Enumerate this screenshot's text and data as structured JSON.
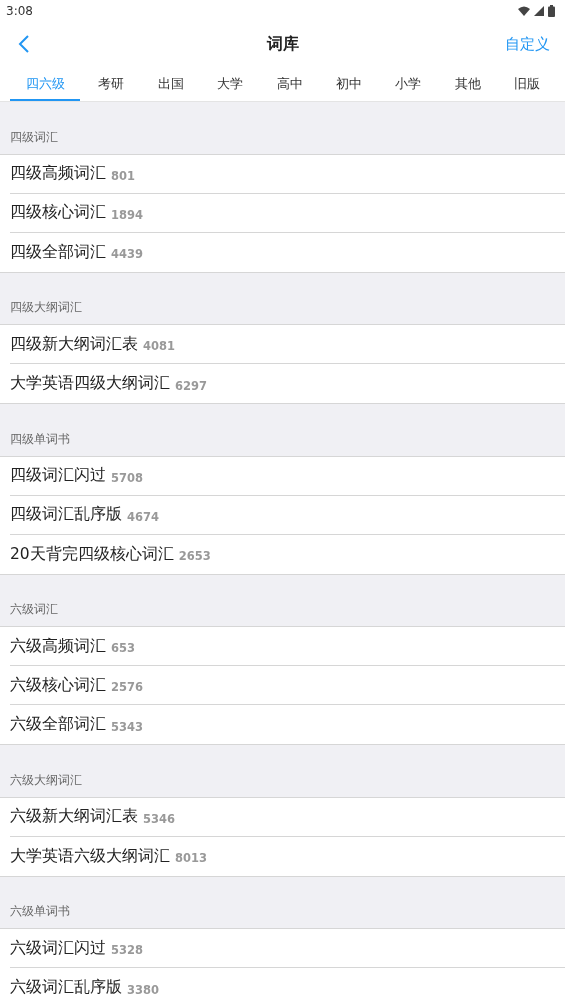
{
  "status_bar": {
    "time": "3:08"
  },
  "header": {
    "title": "词库",
    "action": "自定义"
  },
  "tabs": [
    {
      "label": "四六级",
      "selected": true
    },
    {
      "label": "考研",
      "selected": false
    },
    {
      "label": "出国",
      "selected": false
    },
    {
      "label": "大学",
      "selected": false
    },
    {
      "label": "高中",
      "selected": false
    },
    {
      "label": "初中",
      "selected": false
    },
    {
      "label": "小学",
      "selected": false
    },
    {
      "label": "其他",
      "selected": false
    },
    {
      "label": "旧版",
      "selected": false
    }
  ],
  "sections": [
    {
      "title": "四级词汇",
      "items": [
        {
          "name": "四级高频词汇",
          "count": "801"
        },
        {
          "name": "四级核心词汇",
          "count": "1894"
        },
        {
          "name": "四级全部词汇",
          "count": "4439"
        }
      ]
    },
    {
      "title": "四级大纲词汇",
      "items": [
        {
          "name": "四级新大纲词汇表",
          "count": "4081"
        },
        {
          "name": "大学英语四级大纲词汇",
          "count": "6297"
        }
      ]
    },
    {
      "title": "四级单词书",
      "items": [
        {
          "name": "四级词汇闪过",
          "count": "5708"
        },
        {
          "name": "四级词汇乱序版",
          "count": "4674"
        },
        {
          "name": "20天背完四级核心词汇",
          "count": "2653"
        }
      ]
    },
    {
      "title": "六级词汇",
      "items": [
        {
          "name": "六级高频词汇",
          "count": "653"
        },
        {
          "name": "六级核心词汇",
          "count": "2576"
        },
        {
          "name": "六级全部词汇",
          "count": "5343"
        }
      ]
    },
    {
      "title": "六级大纲词汇",
      "items": [
        {
          "name": "六级新大纲词汇表",
          "count": "5346"
        },
        {
          "name": "大学英语六级大纲词汇",
          "count": "8013"
        }
      ]
    },
    {
      "title": "六级单词书",
      "items": [
        {
          "name": "六级词汇闪过",
          "count": "5328"
        },
        {
          "name": "六级词汇乱序版",
          "count": "3380"
        }
      ]
    }
  ]
}
